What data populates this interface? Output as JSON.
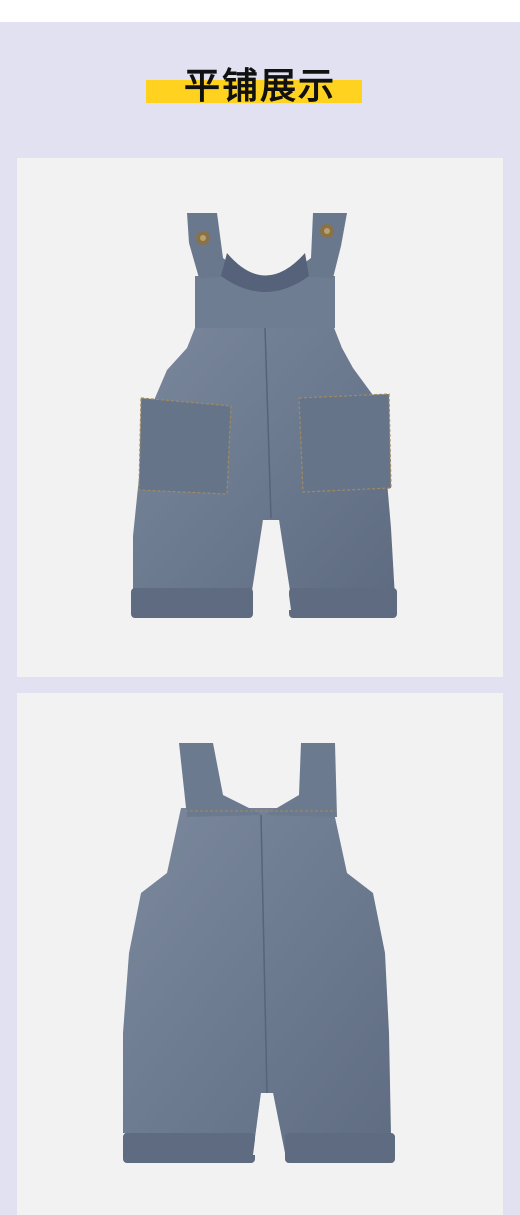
{
  "title": "平铺展示",
  "colors": {
    "background": "#e2e1f2",
    "accent_bar": "#ffd21f",
    "panel": "#f2f2f3",
    "denim": "#6f7d93",
    "denim_dark": "#57657b",
    "stitch": "#a08a5f"
  },
  "panels": [
    {
      "view": "front",
      "icon": "denim-overalls-front"
    },
    {
      "view": "back",
      "icon": "denim-overalls-back"
    }
  ]
}
